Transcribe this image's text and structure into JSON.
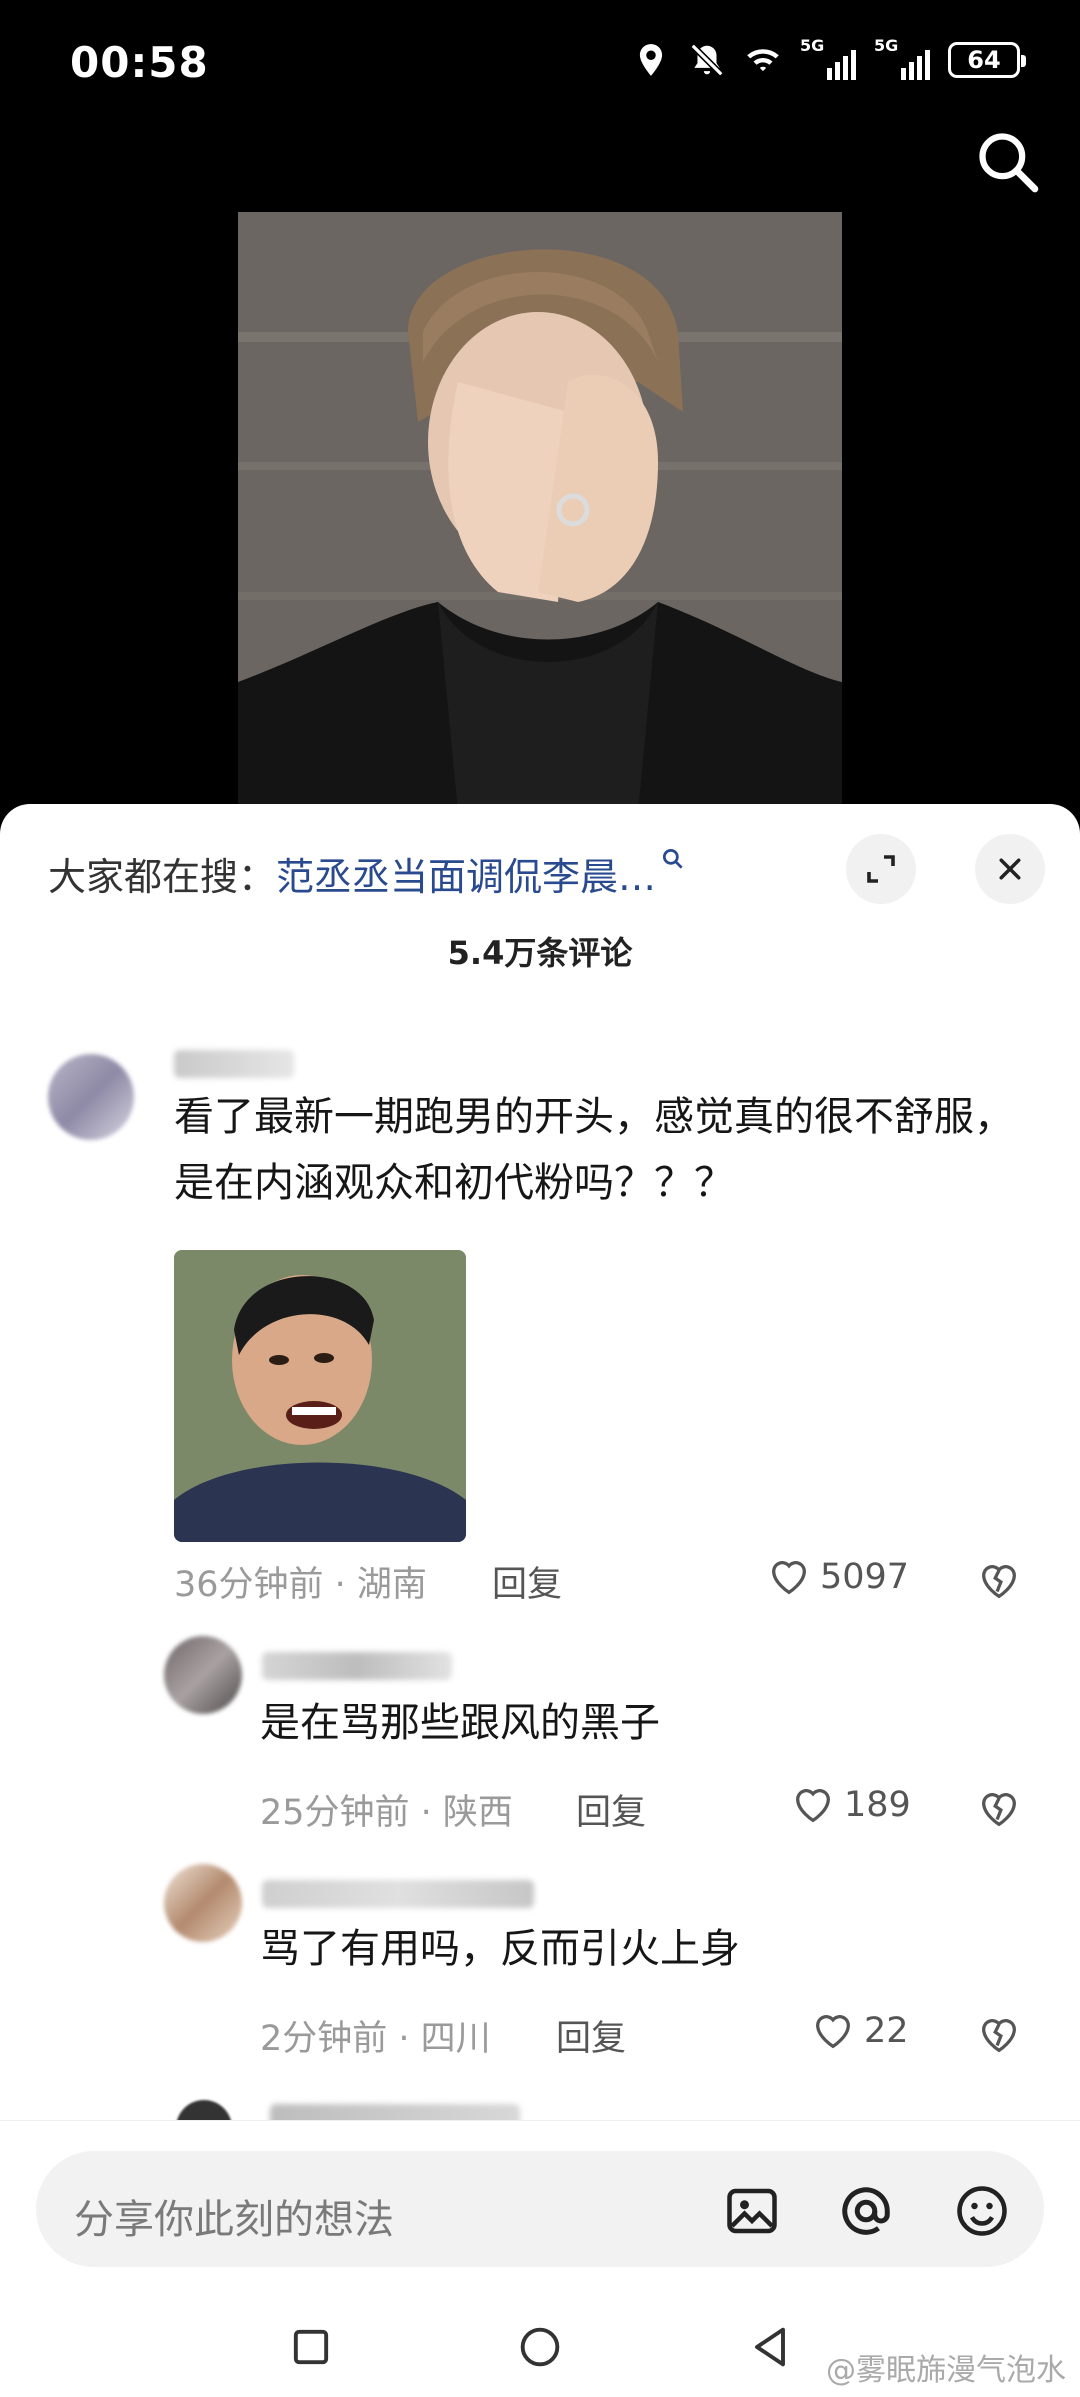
{
  "status_bar": {
    "time": "00:58",
    "network_1": "5G",
    "network_2": "5G",
    "battery": "64"
  },
  "hot_search": {
    "label": "大家都在搜：",
    "term": "范丞丞当面调侃李晨…"
  },
  "comment_count": "5.4万条评论",
  "comments": [
    {
      "text": "看了最新一期跑男的开头，感觉真的很不舒服，是在内涵观众和初代粉吗？？？",
      "time_location": "36分钟前 · 湖南",
      "reply_label": "回复",
      "likes": "5097"
    }
  ],
  "replies": [
    {
      "text": "是在骂那些跟风的黑子",
      "time_location": "25分钟前 · 陕西",
      "reply_label": "回复",
      "likes": "189"
    },
    {
      "text": "骂了有用吗，反而引火上身",
      "time_location": "2分钟前 · 四川",
      "reply_label": "回复",
      "likes": "22"
    }
  ],
  "input": {
    "placeholder": "分享你此刻的想法"
  },
  "watermark": "@雾眠旆漫气泡水",
  "icons": [
    "location-icon",
    "mute-icon",
    "wifi-icon",
    "search-icon",
    "expand-icon",
    "close-icon",
    "heart-icon",
    "broken-heart-icon",
    "image-icon",
    "at-icon",
    "emoji-icon",
    "square-nav-icon",
    "circle-nav-icon",
    "back-nav-icon"
  ],
  "colors": {
    "hot_term": "#2a4a8f",
    "meta": "#9a9a9a",
    "background": "#ffffff"
  }
}
